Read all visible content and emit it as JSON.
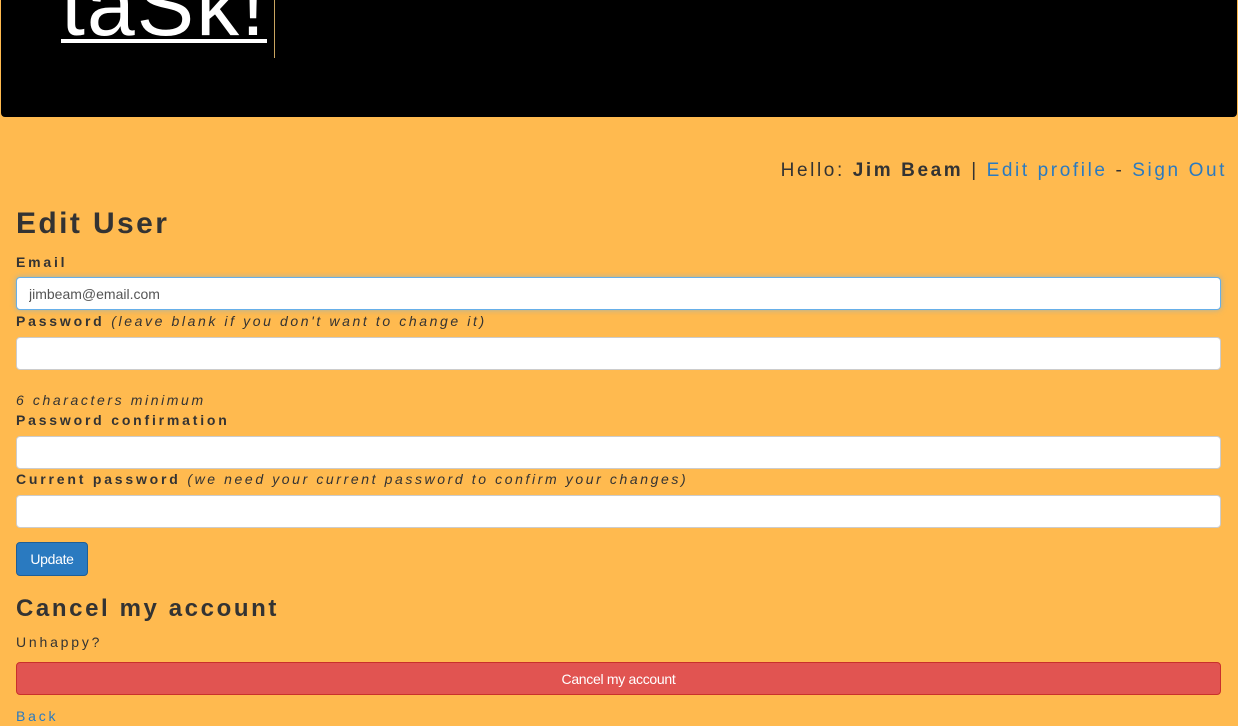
{
  "header": {
    "logo_text": "taSk!"
  },
  "userbar": {
    "greeting": "Hello: ",
    "user_name": "Jim Beam",
    "separator": " | ",
    "edit_profile": "Edit profile",
    "dash": " - ",
    "sign_out": "Sign Out"
  },
  "form": {
    "title": "Edit User",
    "email_label": "Email",
    "email_value": "jimbeam@email.com",
    "password_label": "Password",
    "password_note": "(leave blank if you don't want to change it)",
    "password_hint": "6 characters minimum",
    "password_confirmation_label": "Password confirmation",
    "current_password_label": "Current password",
    "current_password_note": "(we need your current password to confirm your changes)",
    "update_button": "Update"
  },
  "cancel_section": {
    "title": "Cancel my account",
    "prompt": "Unhappy?",
    "cancel_button": "Cancel my account",
    "back_link": "Back"
  },
  "colors": {
    "page_background": "#ffba4f",
    "header_background": "#000000",
    "link": "#2a7ac0",
    "primary_button": "#2a7ac0",
    "danger_button": "#e15451"
  }
}
